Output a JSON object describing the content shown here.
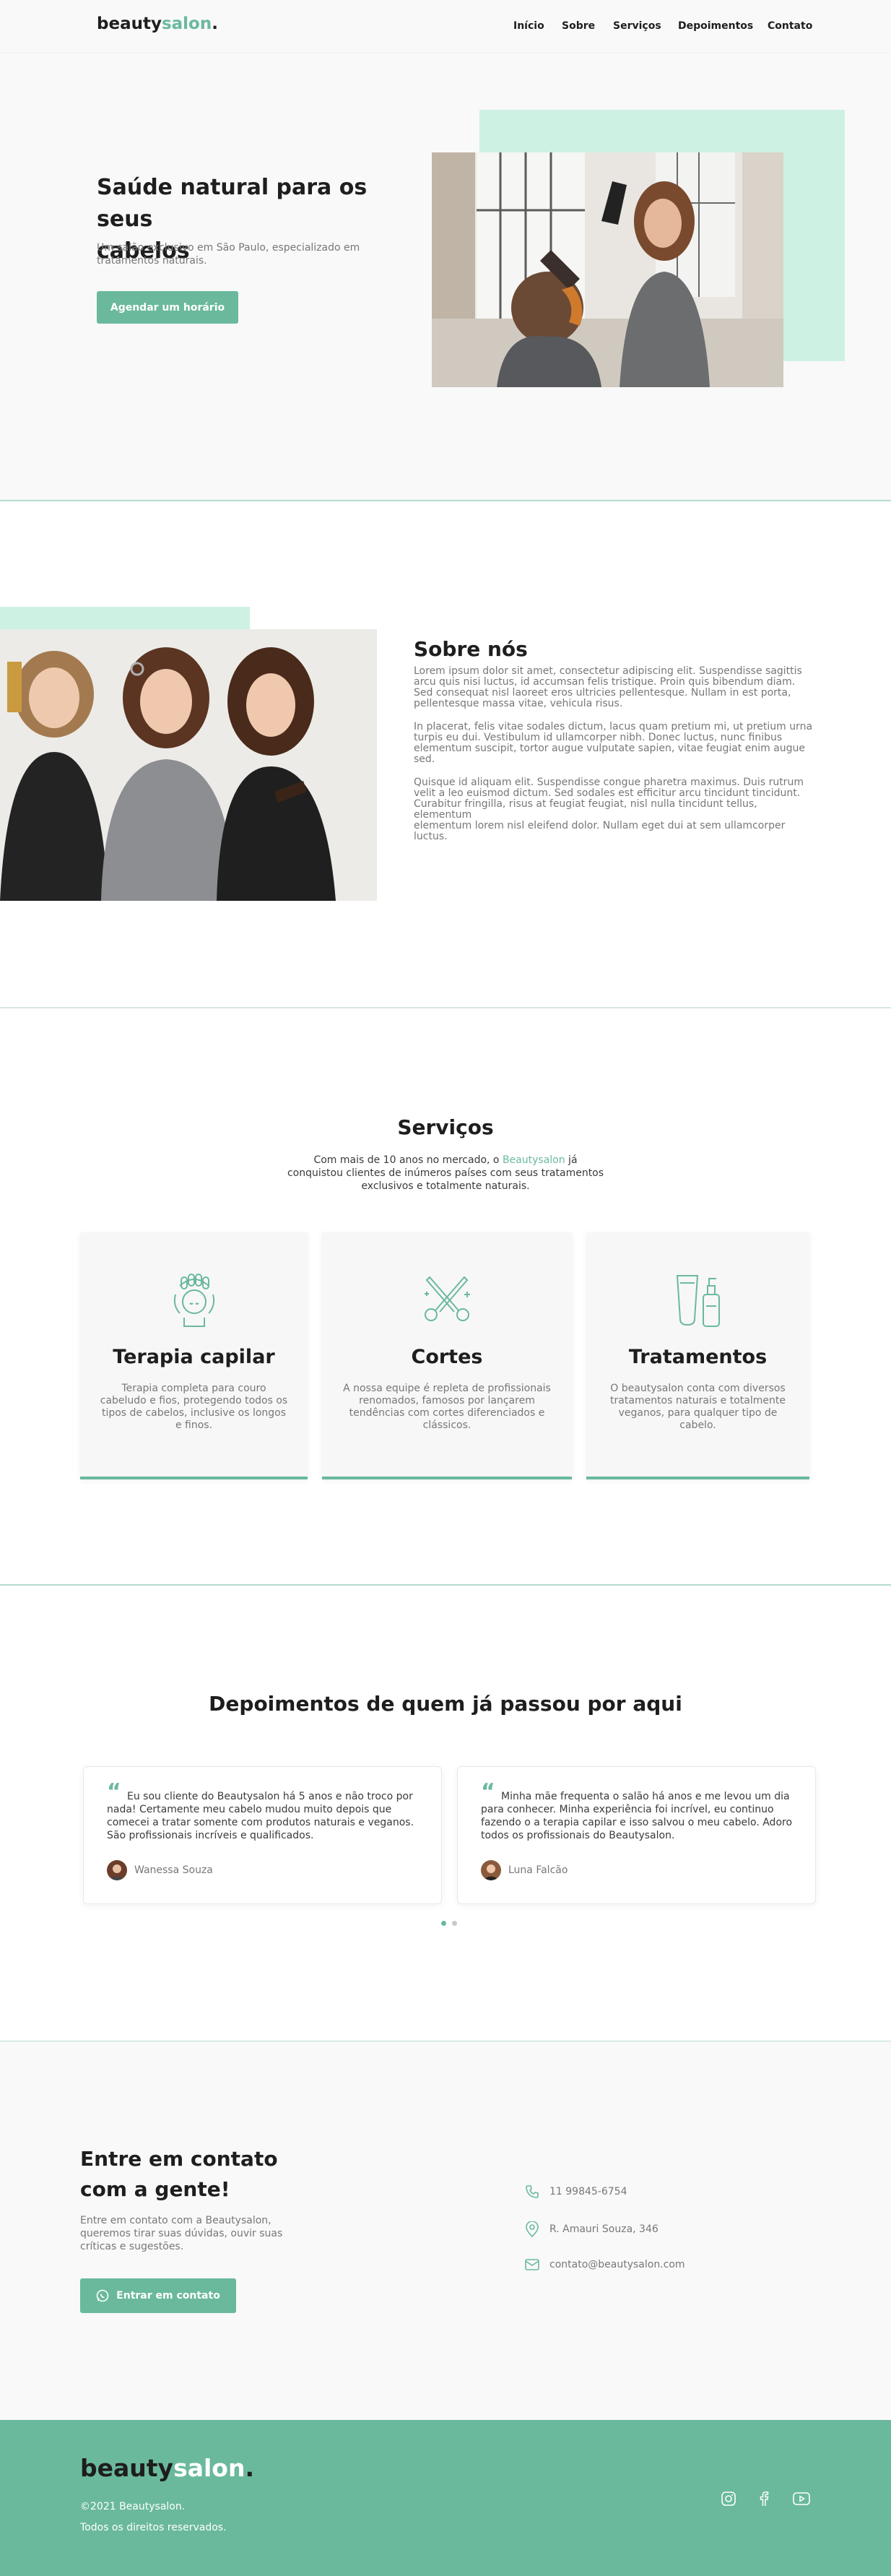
{
  "brand": {
    "name_part1": "beauty",
    "name_part2": "salon",
    "dot": "."
  },
  "nav": {
    "items": [
      "Início",
      "Sobre",
      "Serviços",
      "Depoimentos",
      "Contato"
    ]
  },
  "hero": {
    "title_line1": "Saúde natural para os seus",
    "title_line2": "cabelos",
    "subtitle_line1": "Um salão exclusivo em São Paulo, especializado em",
    "subtitle_line2": "tratamentos naturais.",
    "cta": "Agendar um horário"
  },
  "about": {
    "title": "Sobre nós",
    "paragraphs": [
      [
        "Lorem ipsum dolor sit amet, consectetur adipiscing elit. Suspendisse sagittis",
        "arcu quis nisi luctus, id accumsan felis tristique. Proin quis bibendum diam.",
        "Sed consequat nisl laoreet eros ultricies pellentesque. Nullam in est porta,",
        "pellentesque massa vitae, vehicula risus."
      ],
      [
        "In placerat, felis vitae sodales dictum, lacus quam pretium mi, ut pretium urna",
        "turpis eu dui. Vestibulum id ullamcorper nibh. Donec luctus, nunc finibus",
        "elementum suscipit, tortor augue vulputate sapien, vitae feugiat enim augue",
        "sed."
      ],
      [
        "Quisque id aliquam elit. Suspendisse congue pharetra maximus. Duis rutrum",
        "velit a leo euismod dictum. Sed sodales est efficitur arcu tincidunt tincidunt.",
        "Curabitur fringilla, risus at feugiat feugiat, nisl nulla tincidunt tellus, elementum",
        "elementum lorem nisl eleifend dolor. Nullam eget dui at sem ullamcorper",
        "luctus."
      ]
    ]
  },
  "services": {
    "title": "Serviços",
    "intro_line1_pre": "Com mais de 10 anos no mercado, o ",
    "intro_brand": "Beautysalon",
    "intro_line1_post": " já",
    "intro_line2": "conquistou clientes de inúmeros países com seus tratamentos",
    "intro_line3": "exclusivos e totalmente naturais.",
    "cards": [
      {
        "title": "Terapia capilar",
        "icon": "hair-therapy-icon",
        "lines": [
          "Terapia completa para couro",
          "cabeludo e fios, protegendo todos os",
          "tipos de cabelos, inclusive os longos",
          "e finos."
        ]
      },
      {
        "title": "Cortes",
        "icon": "scissors-icon",
        "lines": [
          "A nossa equipe é repleta de profissionais",
          "renomados, famosos por lançarem",
          "tendências com cortes diferenciados e",
          "clássicos."
        ]
      },
      {
        "title": "Tratamentos",
        "icon": "product-bottles-icon",
        "lines": [
          "O beautysalon conta com diversos",
          "tratamentos naturais e totalmente",
          "veganos, para qualquer tipo de",
          "cabelo."
        ]
      }
    ]
  },
  "testimonials": {
    "title": "Depoimentos de quem já passou por aqui",
    "items": [
      {
        "lines": [
          "Eu sou cliente do Beautysalon há 5 anos e não troco por",
          "nada! Certamente meu cabelo mudou muito depois que",
          "comecei a tratar somente com produtos naturais e veganos.",
          "São profissionais incríveis e qualificados."
        ],
        "author": "Wanessa Souza"
      },
      {
        "lines": [
          "Minha mãe frequenta o salão há anos e me levou um dia",
          "para conhecer. Minha experiência foi incrível, eu continuo",
          "fazendo o a terapia capilar e isso salvou o meu cabelo. Adoro",
          "todos os profissionais do Beautysalon."
        ],
        "author": "Luna Falcão"
      }
    ]
  },
  "contact": {
    "title_line1": "Entre em contato",
    "title_line2": "com a gente!",
    "text_line1": "Entre em contato com a Beautysalon,",
    "text_line2": "queremos tirar suas dúvidas, ouvir suas",
    "text_line3": "críticas e sugestões.",
    "cta": "Entrar em contato",
    "phone": "11 99845-6754",
    "address": "R. Amauri Souza, 346",
    "email": "contato@beautysalon.com"
  },
  "footer": {
    "copyright": "©2021 Beautysalon.",
    "rights": "Todos os direitos reservados."
  },
  "colors": {
    "accent": "#6ab99c",
    "accent_light": "#cdf1e3",
    "text": "#1e1e1e",
    "muted": "#777777"
  }
}
